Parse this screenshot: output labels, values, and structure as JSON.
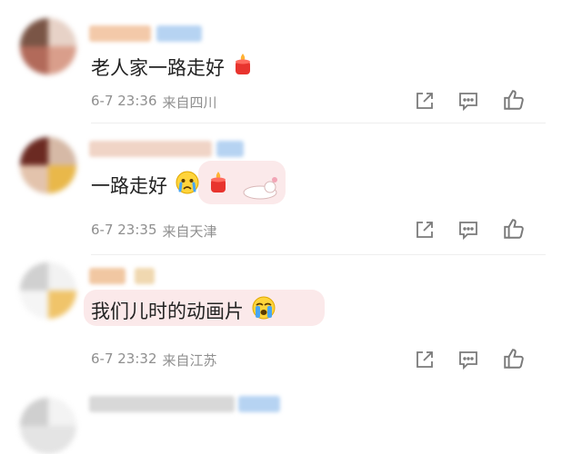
{
  "comments": [
    {
      "text": "老人家一路走好",
      "emojis": [
        "candle-icon"
      ],
      "time": "6-7 23:36",
      "location": "来自四川"
    },
    {
      "text": "一路走好",
      "emojis": [
        "crying-face-icon",
        "candle-icon"
      ],
      "time": "6-7 23:35",
      "location": "来自天津"
    },
    {
      "text": "我们儿时的动画片",
      "emojis": [
        "loudly-crying-face-icon"
      ],
      "time": "6-7 23:32",
      "location": "来自江苏"
    }
  ],
  "colors": {
    "text": "#222222",
    "meta": "#8f8f8f",
    "icon": "#7a7a7a",
    "bubble": "#fbe9ea",
    "divider": "#eeeeee"
  }
}
